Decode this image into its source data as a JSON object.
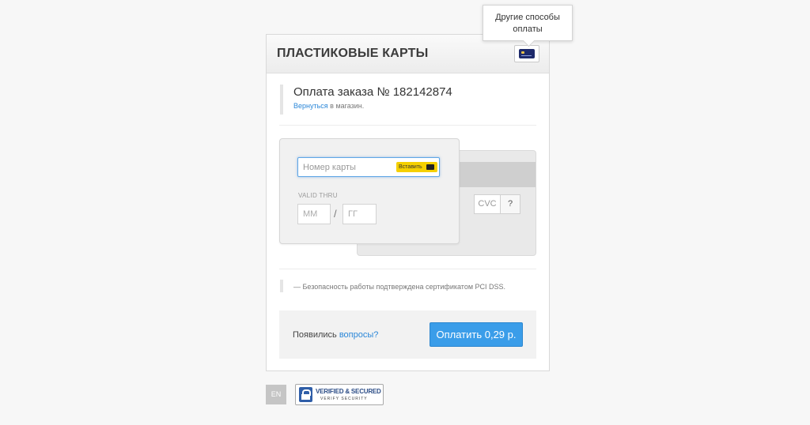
{
  "header": {
    "title": "ПЛАСТИКОВЫЕ КАРТЫ",
    "methods_icon": "credit-card-icon"
  },
  "tooltip": {
    "line1": "Другие способы",
    "line2": "оплаты"
  },
  "order": {
    "title": "Оплата заказа № 182142874",
    "back_link": "Вернуться",
    "back_suffix": " в магазин."
  },
  "card": {
    "number_placeholder": "Номер карты",
    "paste_label": "Вставить",
    "valid_label": "VALID THRU",
    "month_placeholder": "ММ",
    "separator": "/",
    "year_placeholder": "ГГ",
    "cvc_placeholder": "CVC",
    "cvc_help": "?"
  },
  "security_note": "— Безопасность работы подтверждена сертификатом PCI DSS.",
  "footer": {
    "question_prefix": "Появились ",
    "question_link": "вопросы?",
    "pay_label": "Оплатить 0,29 р."
  },
  "bottom": {
    "lang": "EN",
    "badge_line1": "VERIFIED & SECURED",
    "badge_line2": "VERIFY SECURITY"
  },
  "colors": {
    "accent": "#3a9de9",
    "link": "#2b87d8",
    "paste": "#f5d000"
  }
}
